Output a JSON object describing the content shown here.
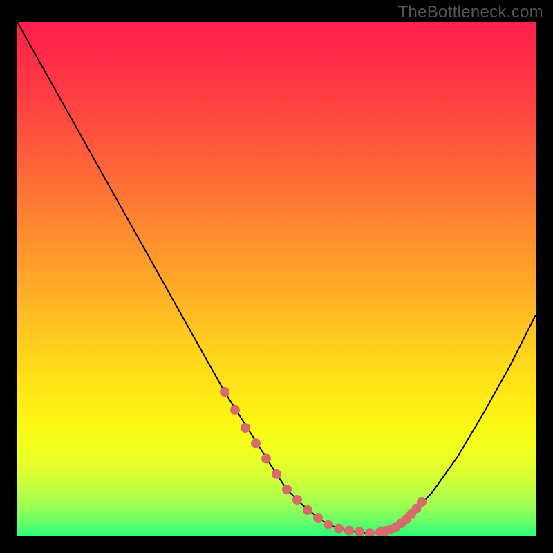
{
  "watermark": "TheBottleneck.com",
  "colors": {
    "background": "#000000",
    "gradient_top": "#ff1f4c",
    "gradient_mid": "#ffd81c",
    "gradient_bottom": "#2bff7b",
    "curve": "#000000",
    "marker": "#d76a6a"
  },
  "chart_data": {
    "type": "line",
    "title": "",
    "xlabel": "",
    "ylabel": "",
    "xlim": [
      0,
      100
    ],
    "ylim": [
      0,
      100
    ],
    "grid": false,
    "legend": false,
    "series": [
      {
        "name": "bottleneck-curve",
        "x": [
          0,
          5,
          10,
          15,
          20,
          25,
          30,
          35,
          40,
          45,
          50,
          52,
          55,
          58,
          60,
          62,
          65,
          68,
          72,
          75,
          80,
          85,
          90,
          95,
          100
        ],
        "y": [
          100,
          91,
          82,
          73,
          64,
          55,
          46,
          37,
          28,
          20,
          12,
          9,
          6,
          3.5,
          2.2,
          1.4,
          0.8,
          0.5,
          1.2,
          3.2,
          8.4,
          15.5,
          24,
          33,
          43
        ]
      }
    ],
    "markers": {
      "name": "highlight-points",
      "x": [
        40,
        42,
        44,
        46,
        48,
        50,
        52,
        54,
        56,
        58,
        60,
        62,
        64,
        66,
        68,
        70,
        71,
        72,
        73,
        74,
        75,
        76,
        77,
        78
      ],
      "y": [
        28,
        24.5,
        21,
        18,
        15,
        12,
        9,
        7,
        5,
        3.5,
        2.2,
        1.4,
        1.0,
        0.8,
        0.5,
        0.7,
        0.9,
        1.2,
        1.7,
        2.4,
        3.2,
        4.2,
        5.3,
        6.6
      ]
    }
  }
}
